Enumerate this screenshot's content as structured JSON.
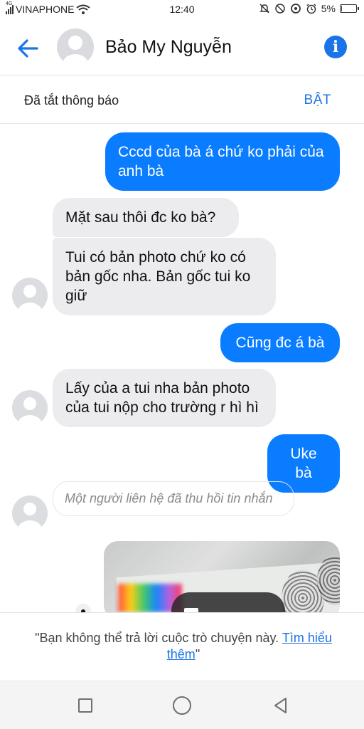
{
  "status_bar": {
    "network_type": "4G",
    "carrier": "VINAPHONE",
    "time": "12:40",
    "battery_percent": "5%",
    "battery_level": 0.05,
    "icons": [
      "signal-icon",
      "wifi-icon",
      "mute-icon",
      "alarm-off-icon",
      "data-saver-icon",
      "alarm-icon",
      "battery-charging-icon"
    ]
  },
  "header": {
    "title": "Bảo My Nguyễn",
    "back_icon": "arrow-left-icon",
    "info_icon": "info-icon",
    "accent": "#0a7cff"
  },
  "notification": {
    "label": "Đã tắt thông báo",
    "action": "BẬT"
  },
  "messages": [
    {
      "side": "out",
      "text": "Cccd của bà á chứ ko phải của anh bà"
    },
    {
      "side": "in",
      "text": "Mặt sau thôi đc ko bà?"
    },
    {
      "side": "in",
      "text": "Tui có bản photo chứ ko có bản gốc nha. Bản gốc tui ko giữ"
    },
    {
      "side": "out",
      "text": "Cũng đc á bà"
    },
    {
      "side": "in",
      "text": "Lấy của a tui nha bản photo của tui nộp cho trường r hì hì"
    },
    {
      "side": "out",
      "text": "Uke bà"
    },
    {
      "side": "in",
      "type": "recalled",
      "text": "Một người liên hệ đã thu hồi tin nhắn"
    },
    {
      "side": "out",
      "type": "photo"
    }
  ],
  "footer": {
    "text_before": "\"Bạn không thể trả lời cuộc trò chuyện này. ",
    "link": "Tìm hiểu thêm",
    "text_after": "\""
  },
  "colors": {
    "outgoing_bubble": "#0a7cff",
    "incoming_bubble": "#ececee",
    "link": "#1b74e4"
  }
}
